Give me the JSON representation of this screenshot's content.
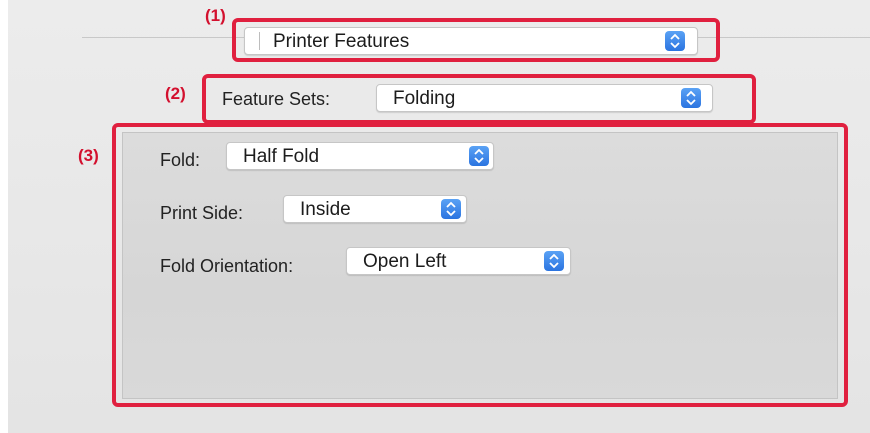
{
  "callouts": {
    "c1": "(1)",
    "c2": "(2)",
    "c3": "(3)"
  },
  "presets_popup": {
    "value": "Printer Features"
  },
  "feature_sets": {
    "label": "Feature Sets:",
    "value": "Folding"
  },
  "folding": {
    "fold": {
      "label": "Fold:",
      "value": "Half Fold"
    },
    "print_side": {
      "label": "Print Side:",
      "value": "Inside"
    },
    "fold_orientation": {
      "label": "Fold Orientation:",
      "value": "Open Left"
    }
  },
  "colors": {
    "callout_red": "#e0203f",
    "stepper_blue": "#2b74e0"
  }
}
